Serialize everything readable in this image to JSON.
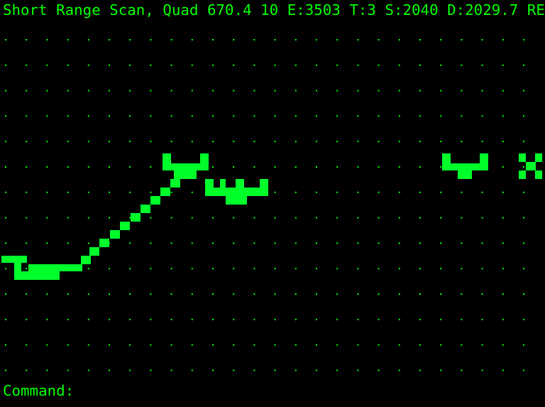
{
  "status": {
    "title": "Short Range Scan,",
    "quad_label": "Quad",
    "quad_value": "670.4 10",
    "energy": "E:3503",
    "torpedoes": "T:3",
    "shields": "S:2040",
    "stardate": "D:2029.7",
    "condition": "RED"
  },
  "command": {
    "prompt": "Command:",
    "value": ""
  },
  "colors": {
    "background": "#000000",
    "text": "#00ff00",
    "grid_dot": "#00ff00",
    "sprite": "#00ff2a"
  },
  "scan": {
    "grid_columns": 26,
    "grid_rows": 14,
    "objects": [
      {
        "name": "player-ship-icon",
        "kind": "ship"
      },
      {
        "name": "phaser-beam",
        "kind": "beam"
      },
      {
        "name": "enemy-ship-1-icon",
        "kind": "enemy"
      },
      {
        "name": "enemy-ship-2-icon",
        "kind": "enemy"
      },
      {
        "name": "enemy-ship-3-icon",
        "kind": "enemy"
      },
      {
        "name": "star-x-icon",
        "kind": "star"
      }
    ]
  }
}
